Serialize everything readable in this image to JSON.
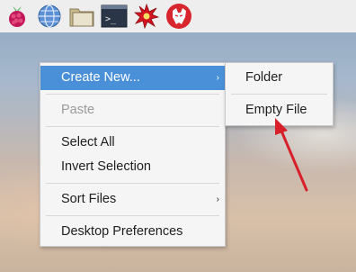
{
  "taskbar": {
    "icons": [
      {
        "name": "raspberry-menu-icon"
      },
      {
        "name": "web-browser-icon"
      },
      {
        "name": "file-manager-icon"
      },
      {
        "name": "terminal-icon"
      },
      {
        "name": "burst-icon"
      },
      {
        "name": "wolfram-icon"
      }
    ],
    "terminal_glyph": ">_"
  },
  "context_menu": {
    "items": {
      "create_new": "Create New...",
      "paste": "Paste",
      "select_all": "Select All",
      "invert_selection": "Invert Selection",
      "sort_files": "Sort Files",
      "desktop_preferences": "Desktop Preferences"
    },
    "submenu_arrow": "›"
  },
  "submenu": {
    "items": {
      "folder": "Folder",
      "empty_file": "Empty File"
    }
  },
  "colors": {
    "highlight": "#4a90d9",
    "annotation_arrow": "#d8202a"
  }
}
